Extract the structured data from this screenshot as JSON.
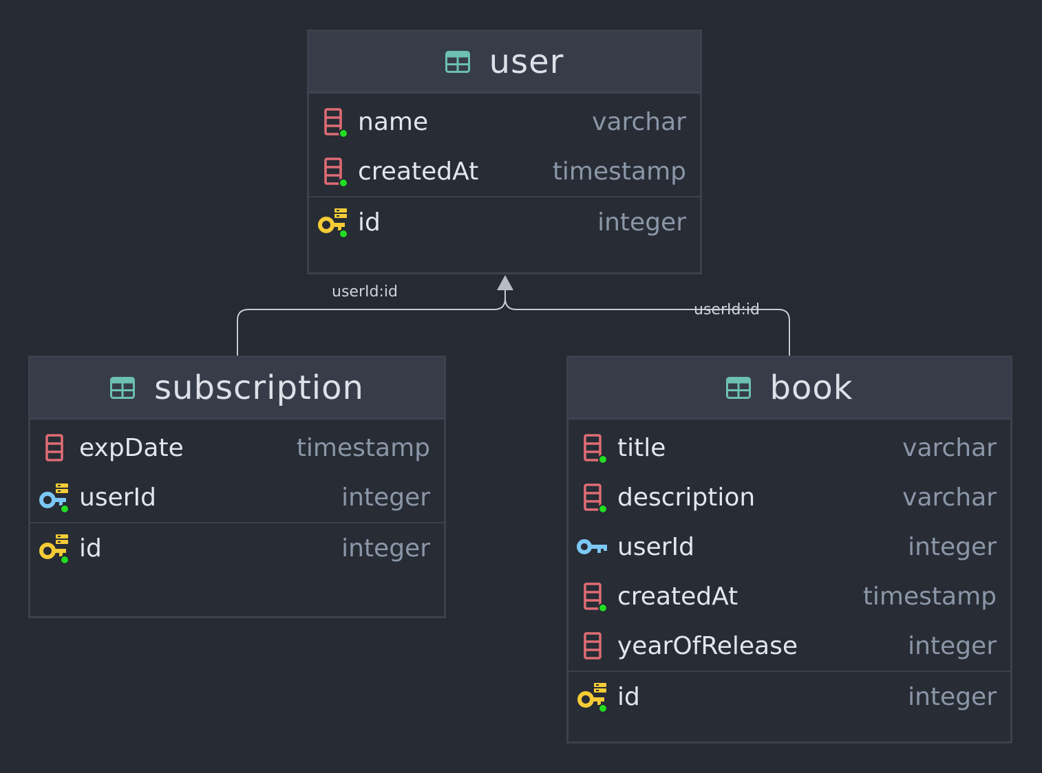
{
  "tables": {
    "user": {
      "name": "user",
      "columns": [
        {
          "name": "name",
          "type": "varchar",
          "icon": "column-not-null-icon"
        },
        {
          "name": "createdAt",
          "type": "timestamp",
          "icon": "column-not-null-icon"
        }
      ],
      "keys": [
        {
          "name": "id",
          "type": "integer",
          "icon": "primary-key-icon"
        }
      ]
    },
    "subscription": {
      "name": "subscription",
      "columns": [
        {
          "name": "expDate",
          "type": "timestamp",
          "icon": "column-icon"
        },
        {
          "name": "userId",
          "type": "integer",
          "icon": "foreign-key-index-icon"
        }
      ],
      "keys": [
        {
          "name": "id",
          "type": "integer",
          "icon": "primary-key-icon"
        }
      ]
    },
    "book": {
      "name": "book",
      "columns": [
        {
          "name": "title",
          "type": "varchar",
          "icon": "column-not-null-icon"
        },
        {
          "name": "description",
          "type": "varchar",
          "icon": "column-not-null-icon"
        },
        {
          "name": "userId",
          "type": "integer",
          "icon": "foreign-key-icon"
        },
        {
          "name": "createdAt",
          "type": "timestamp",
          "icon": "column-not-null-icon"
        },
        {
          "name": "yearOfRelease",
          "type": "integer",
          "icon": "column-icon"
        }
      ],
      "keys": [
        {
          "name": "id",
          "type": "integer",
          "icon": "primary-key-icon"
        }
      ]
    }
  },
  "relations": [
    {
      "from": "subscription",
      "to": "user",
      "label": "userId:id"
    },
    {
      "from": "book",
      "to": "user",
      "label": "userId:id"
    }
  ],
  "colors": {
    "background": "#262a33",
    "table_icon": "#6cc1b0",
    "column_icon": "#e06c75",
    "primary_key": "#f5cc36",
    "foreign_key": "#7cc8f5",
    "not_null_dot": "#22dd22",
    "edge": "#c7ccd3"
  }
}
